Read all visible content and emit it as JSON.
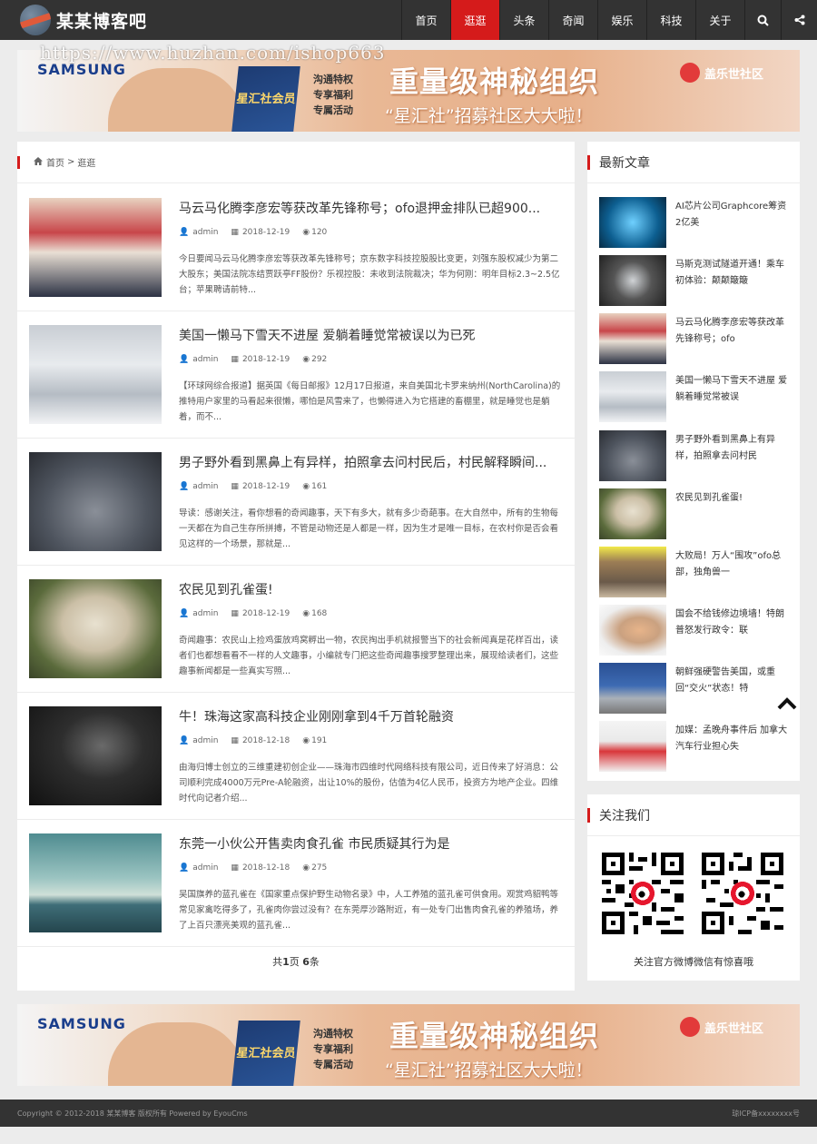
{
  "header": {
    "site_name": "某某博客吧",
    "nav": [
      "首页",
      "逛逛",
      "头条",
      "奇闻",
      "娱乐",
      "科技",
      "关于"
    ],
    "active_nav": "逛逛",
    "search_icon": "search-icon",
    "share_icon": "share-icon"
  },
  "watermark": "https://www.huzhan.com/ishop663",
  "banner": {
    "samsung": "SAMSUNG",
    "card": "星汇社会员",
    "perks": [
      "沟通特权",
      "专享福利",
      "专属活动"
    ],
    "headline": "重量级神秘组织",
    "subline": "“星汇社”招募社区大大啦！",
    "brand": "盖乐世社区"
  },
  "breadcrumb": {
    "home": "首页",
    "separator": ">",
    "current": "逛逛"
  },
  "articles": [
    {
      "title": "马云马化腾李彦宏等获改革先锋称号；ofo退押金排队已超900...",
      "author": "admin",
      "date": "2018-12-19",
      "views": "120",
      "summary": "今日要闻马云马化腾李彦宏等获改革先锋称号；京东数字科技控股股比变更，刘强东股权减少为第二大股东；美国法院冻结贾跃亭FF股份？乐视控股：未收到法院裁决；华为何刚：明年目标2.3~2.5亿台；苹果聘请前特..."
    },
    {
      "title": "美国一懒马下雪天不进屋 爱躺着睡觉常被误以为已死",
      "author": "admin",
      "date": "2018-12-19",
      "views": "292",
      "summary": "【环球网综合报道】据英国《每日邮报》12月17日报道，来自美国北卡罗来纳州(NorthCarolina)的推特用户家里的马看起来很懒，哪怕是风雪来了，也懒得进入为它搭建的畜棚里，就是睡觉也是躺着，而不..."
    },
    {
      "title": "男子野外看到黑鼻上有异样，拍照拿去问村民后，村民解释瞬间...",
      "author": "admin",
      "date": "2018-12-19",
      "views": "161",
      "summary": "导读：感谢关注，看你想看的奇闻趣事，天下有多大，就有多少奇葩事。在大自然中，所有的生物每一天都在为自己生存所拼搏，不管是动物还是人都是一样，因为生才是唯一目标，在农村你是否会看见这样的一个场景，那就是..."
    },
    {
      "title": "农民见到孔雀蛋!",
      "author": "admin",
      "date": "2018-12-19",
      "views": "168",
      "summary": "奇闻趣事：农民山上捡鸡蛋放鸡窝孵出一物，农民掏出手机就报警当下的社会新闻真是花样百出，读者们也都想看看不一样的人文趣事，小编就专门把这些奇闻趣事搜罗整理出来，展现给读者们，这些趣事新闻都是一些真实写照..."
    },
    {
      "title": "牛！珠海这家高科技企业刚刚拿到4千万首轮融资",
      "author": "admin",
      "date": "2018-12-18",
      "views": "191",
      "summary": "由海归博士创立的三维重建初创企业——珠海市四维时代网络科技有限公司，近日传来了好消息：公司顺利完成4000万元Pre-A轮融资，出让10%的股份，估值为4亿人民币，投资方为地产企业。四维时代向记者介绍..."
    },
    {
      "title": "东莞一小伙公开售卖肉食孔雀 市民质疑其行为是",
      "author": "admin",
      "date": "2018-12-18",
      "views": "275",
      "summary": "吴国旗养的蓝孔雀在《国家重点保护野生动物名录》中，人工养殖的蓝孔雀可供食用。观赏鸡貂鸭等常见家禽吃得多了，孔雀肉你尝过没有？在东莞厚沙路附近，有一处专门出售肉食孔雀的养殖场，养了上百只漂亮美观的蓝孔雀..."
    }
  ],
  "pager": {
    "prefix": "共",
    "pages": "1",
    "mid": "页",
    "count": "6",
    "suffix": "条"
  },
  "sidebar": {
    "latest_title": "最新文章",
    "latest": [
      "AI芯片公司Graphcore筹资2亿美",
      "马斯克测试隧道开通！乘车初体验：颠颠簸簸",
      "马云马化腾李彦宏等获改革先锋称号；ofo",
      "美国一懒马下雪天不进屋 爱躺着睡觉常被误",
      "男子野外看到黑鼻上有异样，拍照拿去问村民",
      "农民见到孔雀蛋!",
      "大败局！万人“围攻”ofo总部，独角兽一",
      "国会不给钱修边境墙！特朗普怒发行政令：联",
      "朝鲜强硬警告美国，或重回“交火”状态！特",
      "加媒：孟晚舟事件后 加拿大汽车行业担心失"
    ],
    "follow_title": "关注我们",
    "follow_caption": "关注官方微博微信有惊喜哦"
  },
  "footer": {
    "copyright": "Copyright © 2012-2018 某某博客 版权所有 Powered by EyouCms",
    "icp": "琼ICP备xxxxxxxx号"
  }
}
